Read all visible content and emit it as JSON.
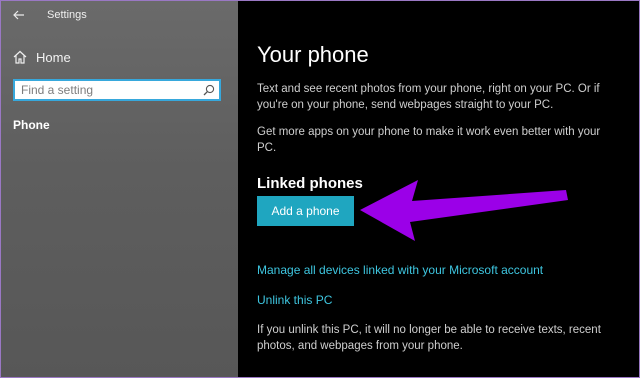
{
  "window": {
    "title": "Settings"
  },
  "sidebar": {
    "home_label": "Home",
    "search": {
      "placeholder": "Find a setting",
      "value": ""
    },
    "items": [
      {
        "label": "Phone"
      }
    ]
  },
  "main": {
    "title": "Your phone",
    "description1": "Text and see recent photos from your phone, right on your PC. Or if you're on your phone, send webpages straight to your PC.",
    "description2": "Get more apps on your phone to make it work even better with your PC.",
    "linked_heading": "Linked phones",
    "add_button_label": "Add a phone",
    "link_manage": "Manage all devices linked with your Microsoft account",
    "link_unlink": "Unlink this PC",
    "unlink_note": "If you unlink this PC, it will no longer be able to receive texts, recent photos, and webpages from your phone."
  },
  "colors": {
    "accent_button": "#1fa6c0",
    "link": "#3ec6e0",
    "annotation_arrow": "#9b00e8",
    "search_border": "#37a8dc"
  },
  "icons": {
    "back": "back-arrow-icon",
    "home": "home-icon",
    "search": "search-icon"
  }
}
